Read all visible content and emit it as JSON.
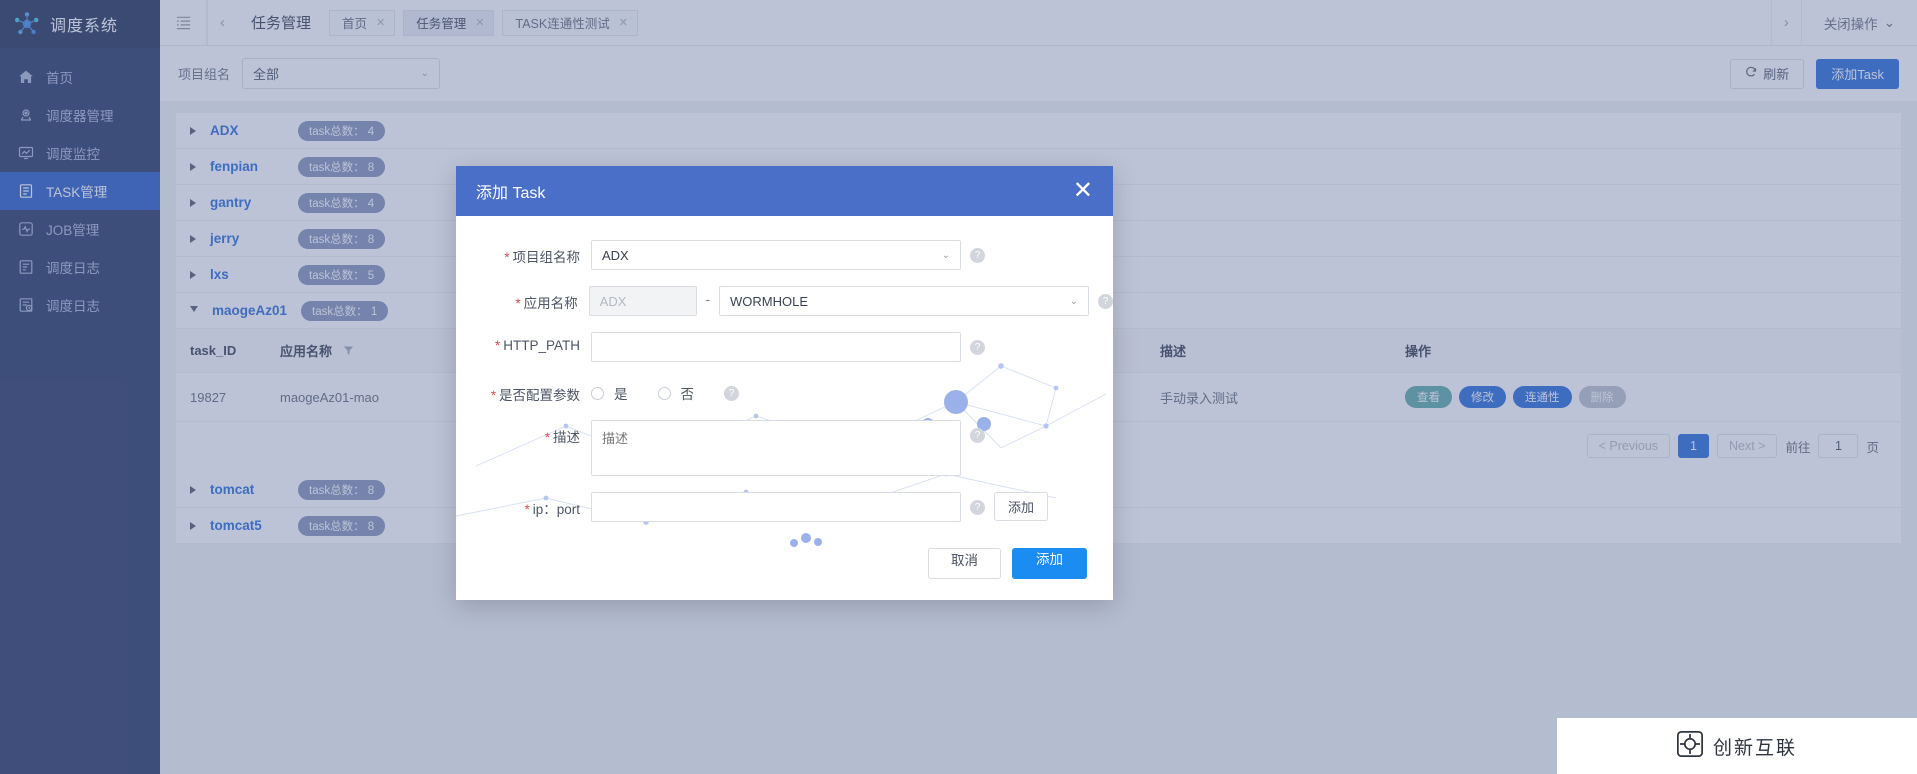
{
  "sidebar": {
    "logo_title": "调度系统",
    "items": [
      {
        "label": "首页",
        "icon": "home-icon",
        "active": false
      },
      {
        "label": "调度器管理",
        "icon": "scheduler-icon",
        "active": false
      },
      {
        "label": "调度监控",
        "icon": "monitor-icon",
        "active": false
      },
      {
        "label": "TASK管理",
        "icon": "task-icon",
        "active": true
      },
      {
        "label": "JOB管理",
        "icon": "job-icon",
        "active": false
      },
      {
        "label": "调度日志",
        "icon": "log-icon",
        "active": false
      },
      {
        "label": "调度日志",
        "icon": "log-clock-icon",
        "active": false
      }
    ]
  },
  "header": {
    "title": "任务管理",
    "tabs": [
      {
        "label": "首页",
        "active": false
      },
      {
        "label": "任务管理",
        "active": true
      },
      {
        "label": "TASK连通性测试",
        "active": false
      }
    ],
    "tab_close": "✕",
    "prev_arrow": "‹",
    "next_arrow": "›",
    "close_ops_label": "关闭操作",
    "close_ops_caret": "⌄"
  },
  "toolbar": {
    "group_label": "项目组名",
    "group_value": "全部",
    "group_caret": "⌄",
    "refresh_label": "刷新",
    "refresh_icon": "refresh-icon",
    "add_task_label": "添加Task"
  },
  "groups": [
    {
      "name": "ADX",
      "badge": "task总数： 4",
      "expanded": false
    },
    {
      "name": "fenpian",
      "badge": "task总数： 8",
      "expanded": false
    },
    {
      "name": "gantry",
      "badge": "task总数： 4",
      "expanded": false
    },
    {
      "name": "jerry",
      "badge": "task总数： 8",
      "expanded": false
    },
    {
      "name": "lxs",
      "badge": "task总数： 5",
      "expanded": false
    },
    {
      "name": "maogeAz01",
      "badge": "task总数： 1",
      "expanded": true
    },
    {
      "name": "tomcat",
      "badge": "task总数： 8",
      "expanded": false
    },
    {
      "name": "tomcat5",
      "badge": "task总数： 8",
      "expanded": false
    }
  ],
  "table": {
    "columns": [
      "task_ID",
      "应用名称",
      "描述",
      "操作"
    ],
    "filter_icon": "filter-icon",
    "rows": [
      {
        "task_id": "19827",
        "app_name": "maogeAz01-mao",
        "desc": "手动录入测试",
        "actions": [
          {
            "label": "查看",
            "style": "view"
          },
          {
            "label": "修改",
            "style": "edit"
          },
          {
            "label": "连通性",
            "style": "conn"
          },
          {
            "label": "删除",
            "style": "del"
          }
        ]
      }
    ]
  },
  "pagination": {
    "prev": "< Previous",
    "current": "1",
    "next": "Next >",
    "jump_prefix": "前往",
    "jump_value": "1",
    "jump_suffix": "页"
  },
  "modal": {
    "title": "添加 Task",
    "close_icon": "close-icon",
    "required_mark": "*",
    "help_icon": "?",
    "fields": {
      "group_name_label": "项目组名称",
      "group_name_value": "ADX",
      "group_name_caret": "⌄",
      "app_name_label": "应用名称",
      "app_name_prefix": "ADX",
      "app_name_separator": "-",
      "app_name_value": "WORMHOLE",
      "app_name_caret": "⌄",
      "http_path_label": "HTTP_PATH",
      "http_path_value": "",
      "config_params_label": "是否配置参数",
      "config_yes": "是",
      "config_no": "否",
      "desc_label": "描述",
      "desc_placeholder": "描述",
      "desc_value": "",
      "ip_port_label": "ip：port",
      "ip_port_value": "",
      "ip_port_add": "添加"
    },
    "cancel_label": "取消",
    "confirm_label": "添加"
  },
  "watermark": {
    "text": "创新互联",
    "icon": "watermark-logo-icon"
  },
  "colors": {
    "sidebar_bg": "#1b2a58",
    "sidebar_active": "#1d53c4",
    "primary": "#1b62d6",
    "modal_header": "#4a6fc8",
    "confirm_blue": "#1b8cf2",
    "badge_gray": "#7e8bb4",
    "view_teal": "#53a6a0",
    "delete_gray": "#b8bdc7",
    "required_red": "#e04a4a",
    "overlay": "rgba(106,122,163,0.45)"
  }
}
